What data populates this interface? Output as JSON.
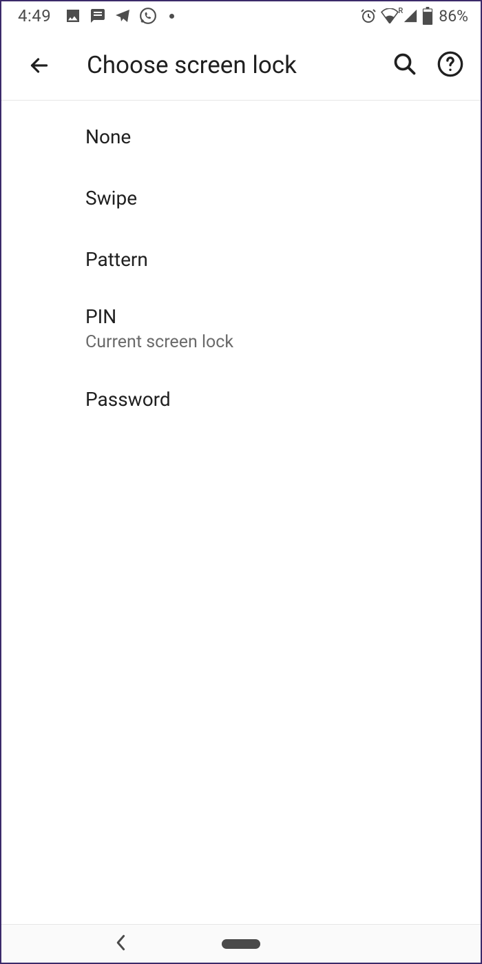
{
  "status": {
    "time": "4:49",
    "battery_text": "86%"
  },
  "header": {
    "title": "Choose screen lock"
  },
  "options": [
    {
      "label": "None",
      "subtitle": null
    },
    {
      "label": "Swipe",
      "subtitle": null
    },
    {
      "label": "Pattern",
      "subtitle": null
    },
    {
      "label": "PIN",
      "subtitle": "Current screen lock"
    },
    {
      "label": "Password",
      "subtitle": null
    }
  ]
}
